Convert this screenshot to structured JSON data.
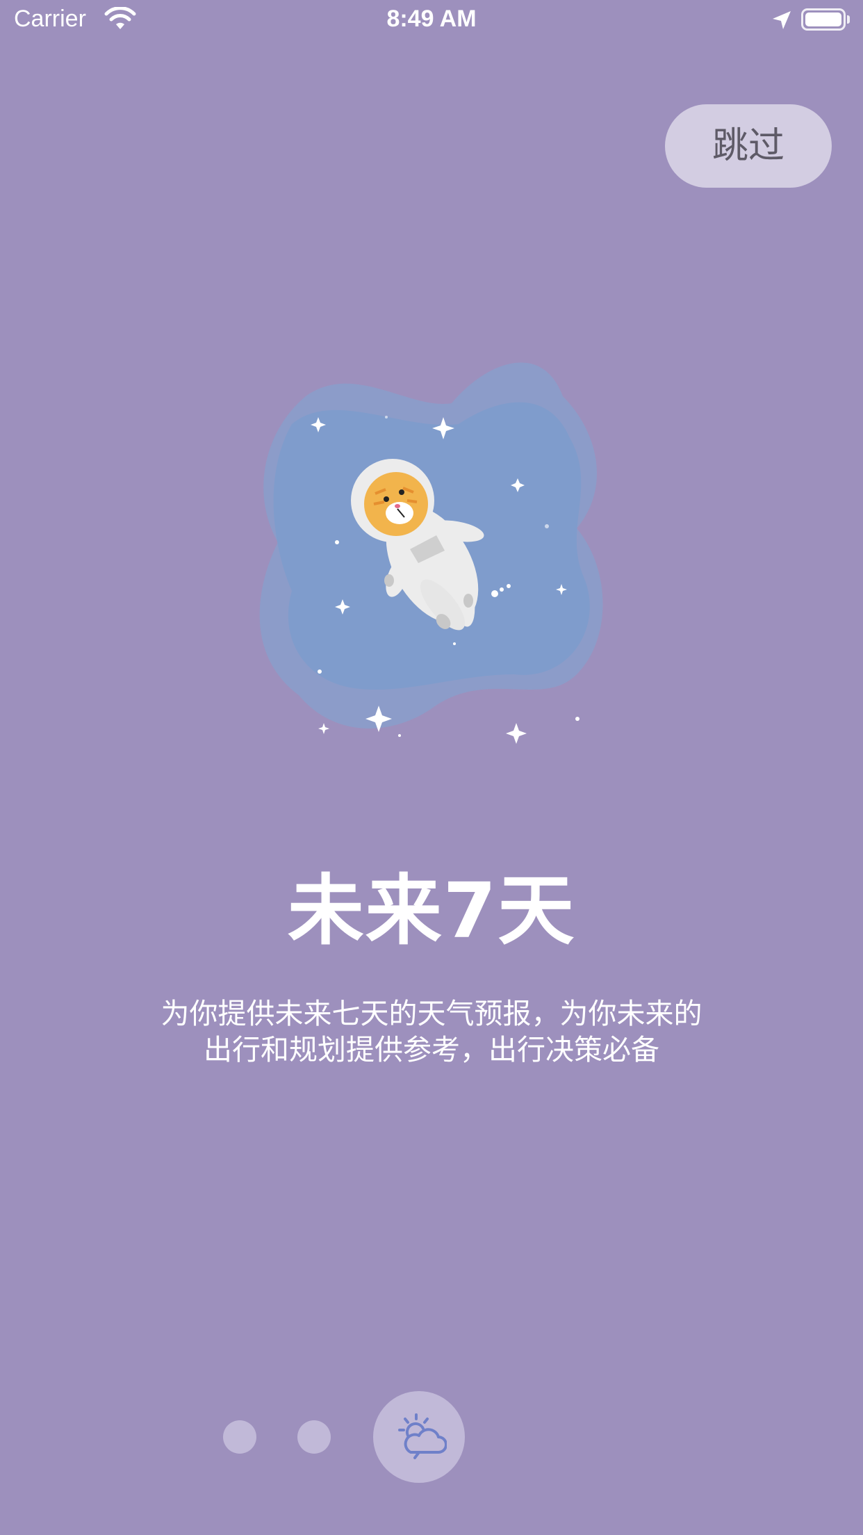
{
  "status_bar": {
    "carrier": "Carrier",
    "time": "8:49 AM"
  },
  "skip_button": {
    "label": "跳过"
  },
  "onboarding": {
    "title": "未来7天",
    "description_line1": "为你提供未来七天的天气预报，为你未来的",
    "description_line2": "出行和规划提供参考，出行决策必备"
  },
  "pager": {
    "total_pages": 3,
    "current_page": 3,
    "current_icon": "weather-partly-cloudy-icon"
  },
  "colors": {
    "background": "#9d90bd",
    "skip_button": "#d3cde2",
    "dot": "#c1b9d8",
    "illustration_blob": "#7f9ccc",
    "weather_icon": "#6f80c9"
  }
}
